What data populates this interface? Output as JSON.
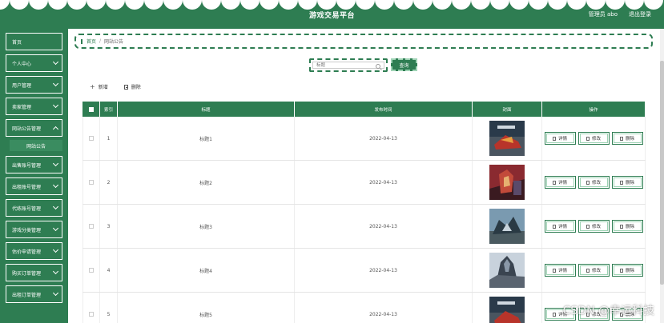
{
  "header": {
    "title": "游戏交易平台",
    "admin_label": "管理员 abo",
    "logout_label": "退出登录"
  },
  "sidebar": {
    "items": [
      {
        "label": "首页"
      },
      {
        "label": "个人中心"
      },
      {
        "label": "用户管理"
      },
      {
        "label": "卖家管理"
      },
      {
        "label": "网站公告管理"
      },
      {
        "label": "出售账号管理"
      },
      {
        "label": "出租账号管理"
      },
      {
        "label": "代练账号管理"
      },
      {
        "label": "游戏分类管理"
      },
      {
        "label": "估价申请管理"
      },
      {
        "label": "购买订单管理"
      },
      {
        "label": "出租订单管理"
      }
    ],
    "submenu": "网站公告"
  },
  "breadcrumb": {
    "home": "首页",
    "sep": "/",
    "current": "网站公告"
  },
  "search": {
    "placeholder": "标题",
    "button": "查询"
  },
  "toolbar": {
    "add": "新增",
    "delete": "删除"
  },
  "table": {
    "headers": {
      "index": "索引",
      "title": "标题",
      "date": "发布时间",
      "image": "封面",
      "ops": "操作"
    },
    "ops": {
      "detail": "详情",
      "edit": "修改",
      "delete": "删除"
    },
    "rows": [
      {
        "index": "1",
        "title": "标题1",
        "date": "2022-04-13"
      },
      {
        "index": "2",
        "title": "标题2",
        "date": "2022-04-13"
      },
      {
        "index": "3",
        "title": "标题3",
        "date": "2022-04-13"
      },
      {
        "index": "4",
        "title": "标题4",
        "date": "2022-04-13"
      },
      {
        "index": "5",
        "title": "标题5",
        "date": "2022-04-13"
      }
    ]
  },
  "watermark": "CSDN @幸运科技",
  "colors": {
    "primary": "#2e7d52",
    "accent": "#9fd3b5"
  }
}
